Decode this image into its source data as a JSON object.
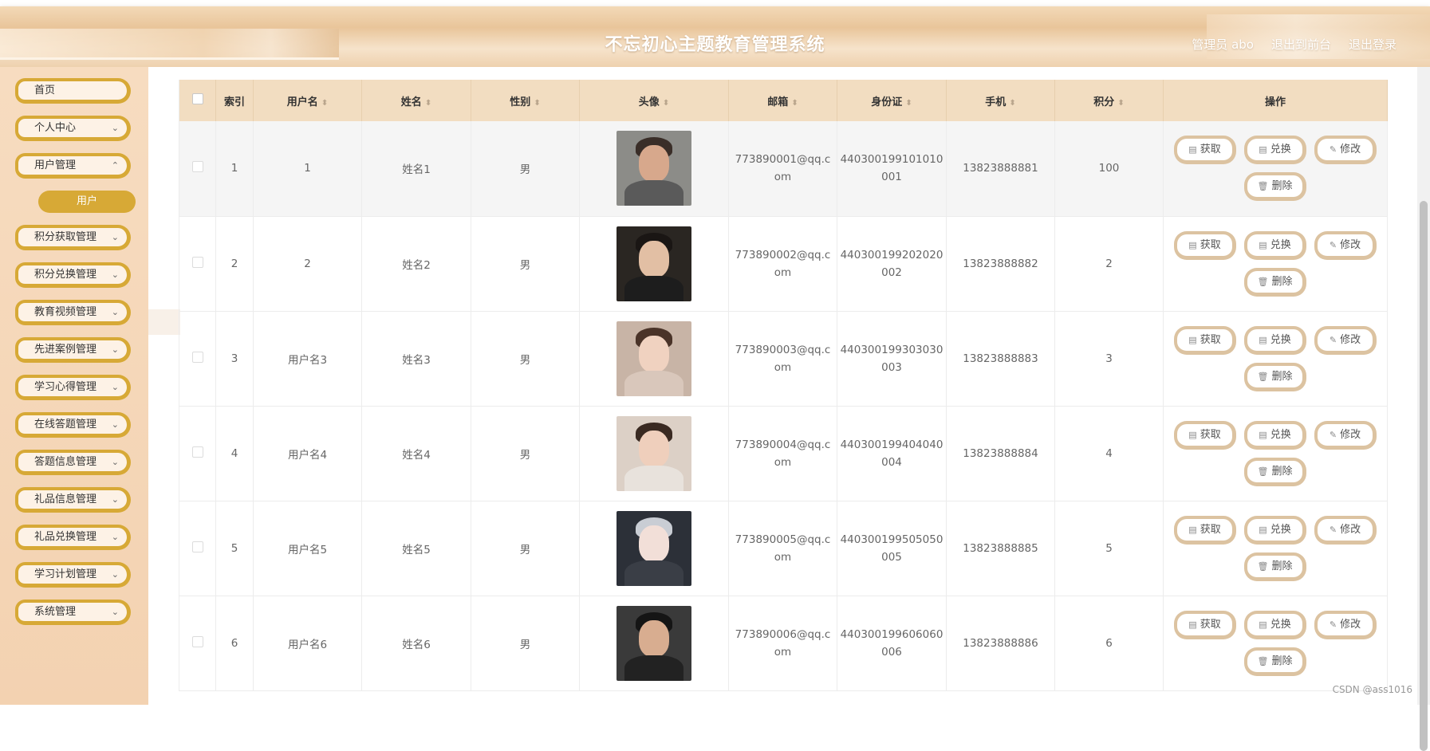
{
  "header": {
    "title": "不忘初心主题教育管理系统",
    "links": [
      "管理员 abo",
      "退出到前台",
      "退出登录"
    ]
  },
  "sidebar": {
    "items": [
      {
        "label": "首页",
        "has_children": false
      },
      {
        "label": "个人中心",
        "has_children": true
      },
      {
        "label": "用户管理",
        "has_children": true
      },
      {
        "label": "积分获取管理",
        "has_children": true
      },
      {
        "label": "积分兑换管理",
        "has_children": true
      },
      {
        "label": "教育视频管理",
        "has_children": true
      },
      {
        "label": "先进案例管理",
        "has_children": true
      },
      {
        "label": "学习心得管理",
        "has_children": true
      },
      {
        "label": "在线答题管理",
        "has_children": true
      },
      {
        "label": "答题信息管理",
        "has_children": true
      },
      {
        "label": "礼品信息管理",
        "has_children": true
      },
      {
        "label": "礼品兑换管理",
        "has_children": true
      },
      {
        "label": "学习计划管理",
        "has_children": true
      },
      {
        "label": "系统管理",
        "has_children": true
      }
    ],
    "active_sub": "用户"
  },
  "table": {
    "columns": [
      "索引",
      "用户名",
      "姓名",
      "性别",
      "头像",
      "邮箱",
      "身份证",
      "手机",
      "积分",
      "操作"
    ],
    "rows": [
      {
        "index": "1",
        "username": "1",
        "name": "姓名1",
        "gender": "男",
        "email_a": "773890001@qq.c",
        "email_b": "om",
        "id_a": "440300199101010",
        "id_b": "001",
        "phone": "13823888881",
        "points": "100"
      },
      {
        "index": "2",
        "username": "2",
        "name": "姓名2",
        "gender": "男",
        "email_a": "773890002@qq.c",
        "email_b": "om",
        "id_a": "440300199202020",
        "id_b": "002",
        "phone": "13823888882",
        "points": "2"
      },
      {
        "index": "3",
        "username": "用户名3",
        "name": "姓名3",
        "gender": "男",
        "email_a": "773890003@qq.c",
        "email_b": "om",
        "id_a": "440300199303030",
        "id_b": "003",
        "phone": "13823888883",
        "points": "3"
      },
      {
        "index": "4",
        "username": "用户名4",
        "name": "姓名4",
        "gender": "男",
        "email_a": "773890004@qq.c",
        "email_b": "om",
        "id_a": "440300199404040",
        "id_b": "004",
        "phone": "13823888884",
        "points": "4"
      },
      {
        "index": "5",
        "username": "用户名5",
        "name": "姓名5",
        "gender": "男",
        "email_a": "773890005@qq.c",
        "email_b": "om",
        "id_a": "440300199505050",
        "id_b": "005",
        "phone": "13823888885",
        "points": "5"
      },
      {
        "index": "6",
        "username": "用户名6",
        "name": "姓名6",
        "gender": "男",
        "email_a": "773890006@qq.c",
        "email_b": "om",
        "id_a": "440300199606060",
        "id_b": "006",
        "phone": "13823888886",
        "points": "6"
      }
    ],
    "actions": {
      "get": "获取",
      "exchange": "兑换",
      "edit": "修改",
      "delete": "删除"
    }
  },
  "watermark": "CSDN @ass1016",
  "colors": {
    "accent": "#d7a936",
    "header_bg": "#f2ddc1",
    "sidebar_bg": "#f7dcc0"
  }
}
